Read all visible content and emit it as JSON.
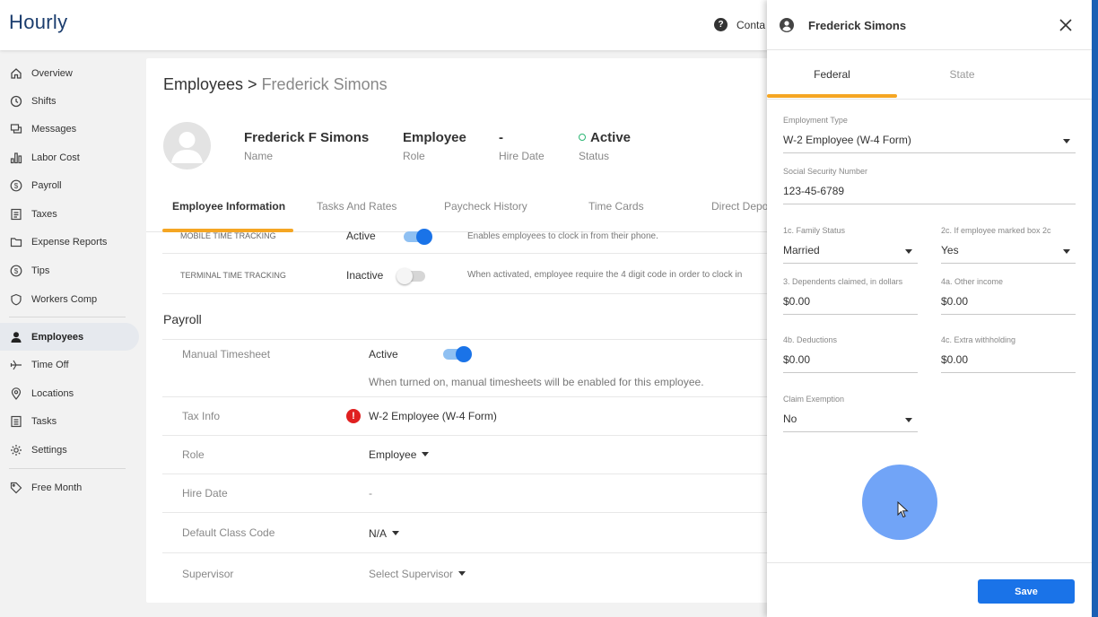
{
  "app": {
    "logo": "Hourly"
  },
  "topbar": {
    "help_label": "Conta"
  },
  "sidebar": {
    "items": [
      {
        "label": "Overview",
        "icon": "home-icon"
      },
      {
        "label": "Shifts",
        "icon": "clock-icon"
      },
      {
        "label": "Messages",
        "icon": "messages-icon"
      },
      {
        "label": "Labor Cost",
        "icon": "bar-chart-icon"
      },
      {
        "label": "Payroll",
        "icon": "dollar-circle-icon"
      },
      {
        "label": "Taxes",
        "icon": "document-icon"
      },
      {
        "label": "Expense Reports",
        "icon": "folder-icon"
      },
      {
        "label": "Tips",
        "icon": "dollar-circle-icon"
      },
      {
        "label": "Workers Comp",
        "icon": "shield-icon"
      },
      {
        "label": "Employees",
        "icon": "person-icon",
        "active": true
      },
      {
        "label": "Time Off",
        "icon": "plane-icon"
      },
      {
        "label": "Locations",
        "icon": "location-pin-icon"
      },
      {
        "label": "Tasks",
        "icon": "list-icon"
      },
      {
        "label": "Settings",
        "icon": "gear-icon"
      },
      {
        "label": "Free Month",
        "icon": "tag-icon"
      }
    ]
  },
  "main": {
    "breadcrumb": {
      "parent": "Employees",
      "separator": " > ",
      "current": "Frederick Simons"
    },
    "summary": {
      "name": {
        "value": "Frederick F Simons",
        "label": "Name"
      },
      "role": {
        "value": "Employee",
        "label": "Role"
      },
      "hire_date": {
        "value": "-",
        "label": "Hire Date"
      },
      "status": {
        "value": "Active",
        "label": "Status"
      }
    },
    "tabs": [
      "Employee Information",
      "Tasks And Rates",
      "Paycheck History",
      "Time Cards",
      "Direct Depo"
    ],
    "tracking": [
      {
        "label": "MOBILE TIME TRACKING",
        "state": "Active",
        "on": true,
        "description": "Enables employees to clock in from their phone."
      },
      {
        "label": "TERMINAL TIME TRACKING",
        "state": "Inactive",
        "on": false,
        "description": "When activated, employee require the 4 digit code in order to clock in"
      }
    ],
    "payroll": {
      "title": "Payroll",
      "manual_timesheet": {
        "label": "Manual Timesheet",
        "state": "Active",
        "description": "When turned on, manual timesheets will be enabled for this employee."
      },
      "tax_info": {
        "label": "Tax Info",
        "value": "W-2 Employee (W-4 Form)"
      },
      "role": {
        "label": "Role",
        "value": "Employee"
      },
      "hire_date": {
        "label": "Hire Date",
        "value": "-"
      },
      "default_class_code": {
        "label": "Default Class Code",
        "value": "N/A"
      },
      "supervisor": {
        "label": "Supervisor",
        "value": "Select Supervisor"
      }
    }
  },
  "panel": {
    "title": "Frederick Simons",
    "tabs": [
      "Federal",
      "State"
    ],
    "fields": {
      "employment_type": {
        "label": "Employment Type",
        "value": "W-2 Employee (W-4 Form)"
      },
      "ssn": {
        "label": "Social Security Number",
        "value": "123-45-6789"
      },
      "family_status": {
        "label": "1c. Family Status",
        "value": "Married"
      },
      "box_2c": {
        "label": "2c. If employee marked box 2c",
        "value": "Yes"
      },
      "dependents": {
        "label": "3. Dependents claimed, in dollars",
        "value": "$0.00"
      },
      "other_income": {
        "label": "4a. Other income",
        "value": "$0.00"
      },
      "deductions": {
        "label": "4b. Deductions",
        "value": "$0.00"
      },
      "extra_withholding": {
        "label": "4c. Extra withholding",
        "value": "$0.00"
      },
      "claim_exemption": {
        "label": "Claim Exemption",
        "value": "No"
      }
    },
    "save_label": "Save"
  },
  "colors": {
    "accent": "#f5a623",
    "primary": "#1a73e8",
    "brand": "#1b3d6e",
    "alert": "#e02020",
    "success": "#2bb673"
  }
}
